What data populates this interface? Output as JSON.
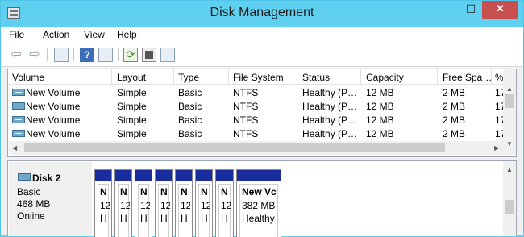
{
  "window": {
    "title": "Disk Management",
    "min_glyph": "—",
    "max_glyph": "☐",
    "close_glyph": "✕"
  },
  "menu": {
    "items": [
      "File",
      "Action",
      "View",
      "Help"
    ]
  },
  "toolbar": {
    "back_glyph": "⇦",
    "forward_glyph": "⇨",
    "help_glyph": "?",
    "refresh_glyph": "⟳",
    "icons": [
      "back-icon",
      "forward-icon",
      "console-tree-icon",
      "help-icon",
      "properties-pane-icon",
      "refresh-icon",
      "properties-icon",
      "rescan-icon"
    ]
  },
  "volume_list": {
    "columns": [
      "Volume",
      "Layout",
      "Type",
      "File System",
      "Status",
      "Capacity",
      "Free Spa…",
      "%"
    ],
    "rows": [
      [
        "New Volume",
        "Simple",
        "Basic",
        "NTFS",
        "Healthy (P…",
        "12 MB",
        "2 MB",
        "17"
      ],
      [
        "New Volume",
        "Simple",
        "Basic",
        "NTFS",
        "Healthy (P…",
        "12 MB",
        "2 MB",
        "17"
      ],
      [
        "New Volume",
        "Simple",
        "Basic",
        "NTFS",
        "Healthy (P…",
        "12 MB",
        "2 MB",
        "17"
      ],
      [
        "New Volume",
        "Simple",
        "Basic",
        "NTFS",
        "Healthy (P…",
        "12 MB",
        "2 MB",
        "17"
      ]
    ],
    "scroll_left_glyph": "◀",
    "scroll_right_glyph": "▶",
    "scroll_up_glyph": "▲",
    "scroll_down_glyph": "▼"
  },
  "disk": {
    "name": "Disk 2",
    "type": "Basic",
    "size": "468 MB",
    "state": "Online",
    "partitions": [
      {
        "name": "N",
        "size": "12",
        "status": "H"
      },
      {
        "name": "N",
        "size": "12",
        "status": "H"
      },
      {
        "name": "N",
        "size": "12",
        "status": "H"
      },
      {
        "name": "N",
        "size": "12",
        "status": "H"
      },
      {
        "name": "N",
        "size": "12",
        "status": "H"
      },
      {
        "name": "N",
        "size": "12",
        "status": "H"
      },
      {
        "name": "New Vc",
        "size": "382 MB",
        "status": "Healthy"
      }
    ]
  },
  "colors": {
    "titlebar": "#60d0f0",
    "partition_header": "#1a2d9c",
    "close_button": "#c74f4f"
  }
}
